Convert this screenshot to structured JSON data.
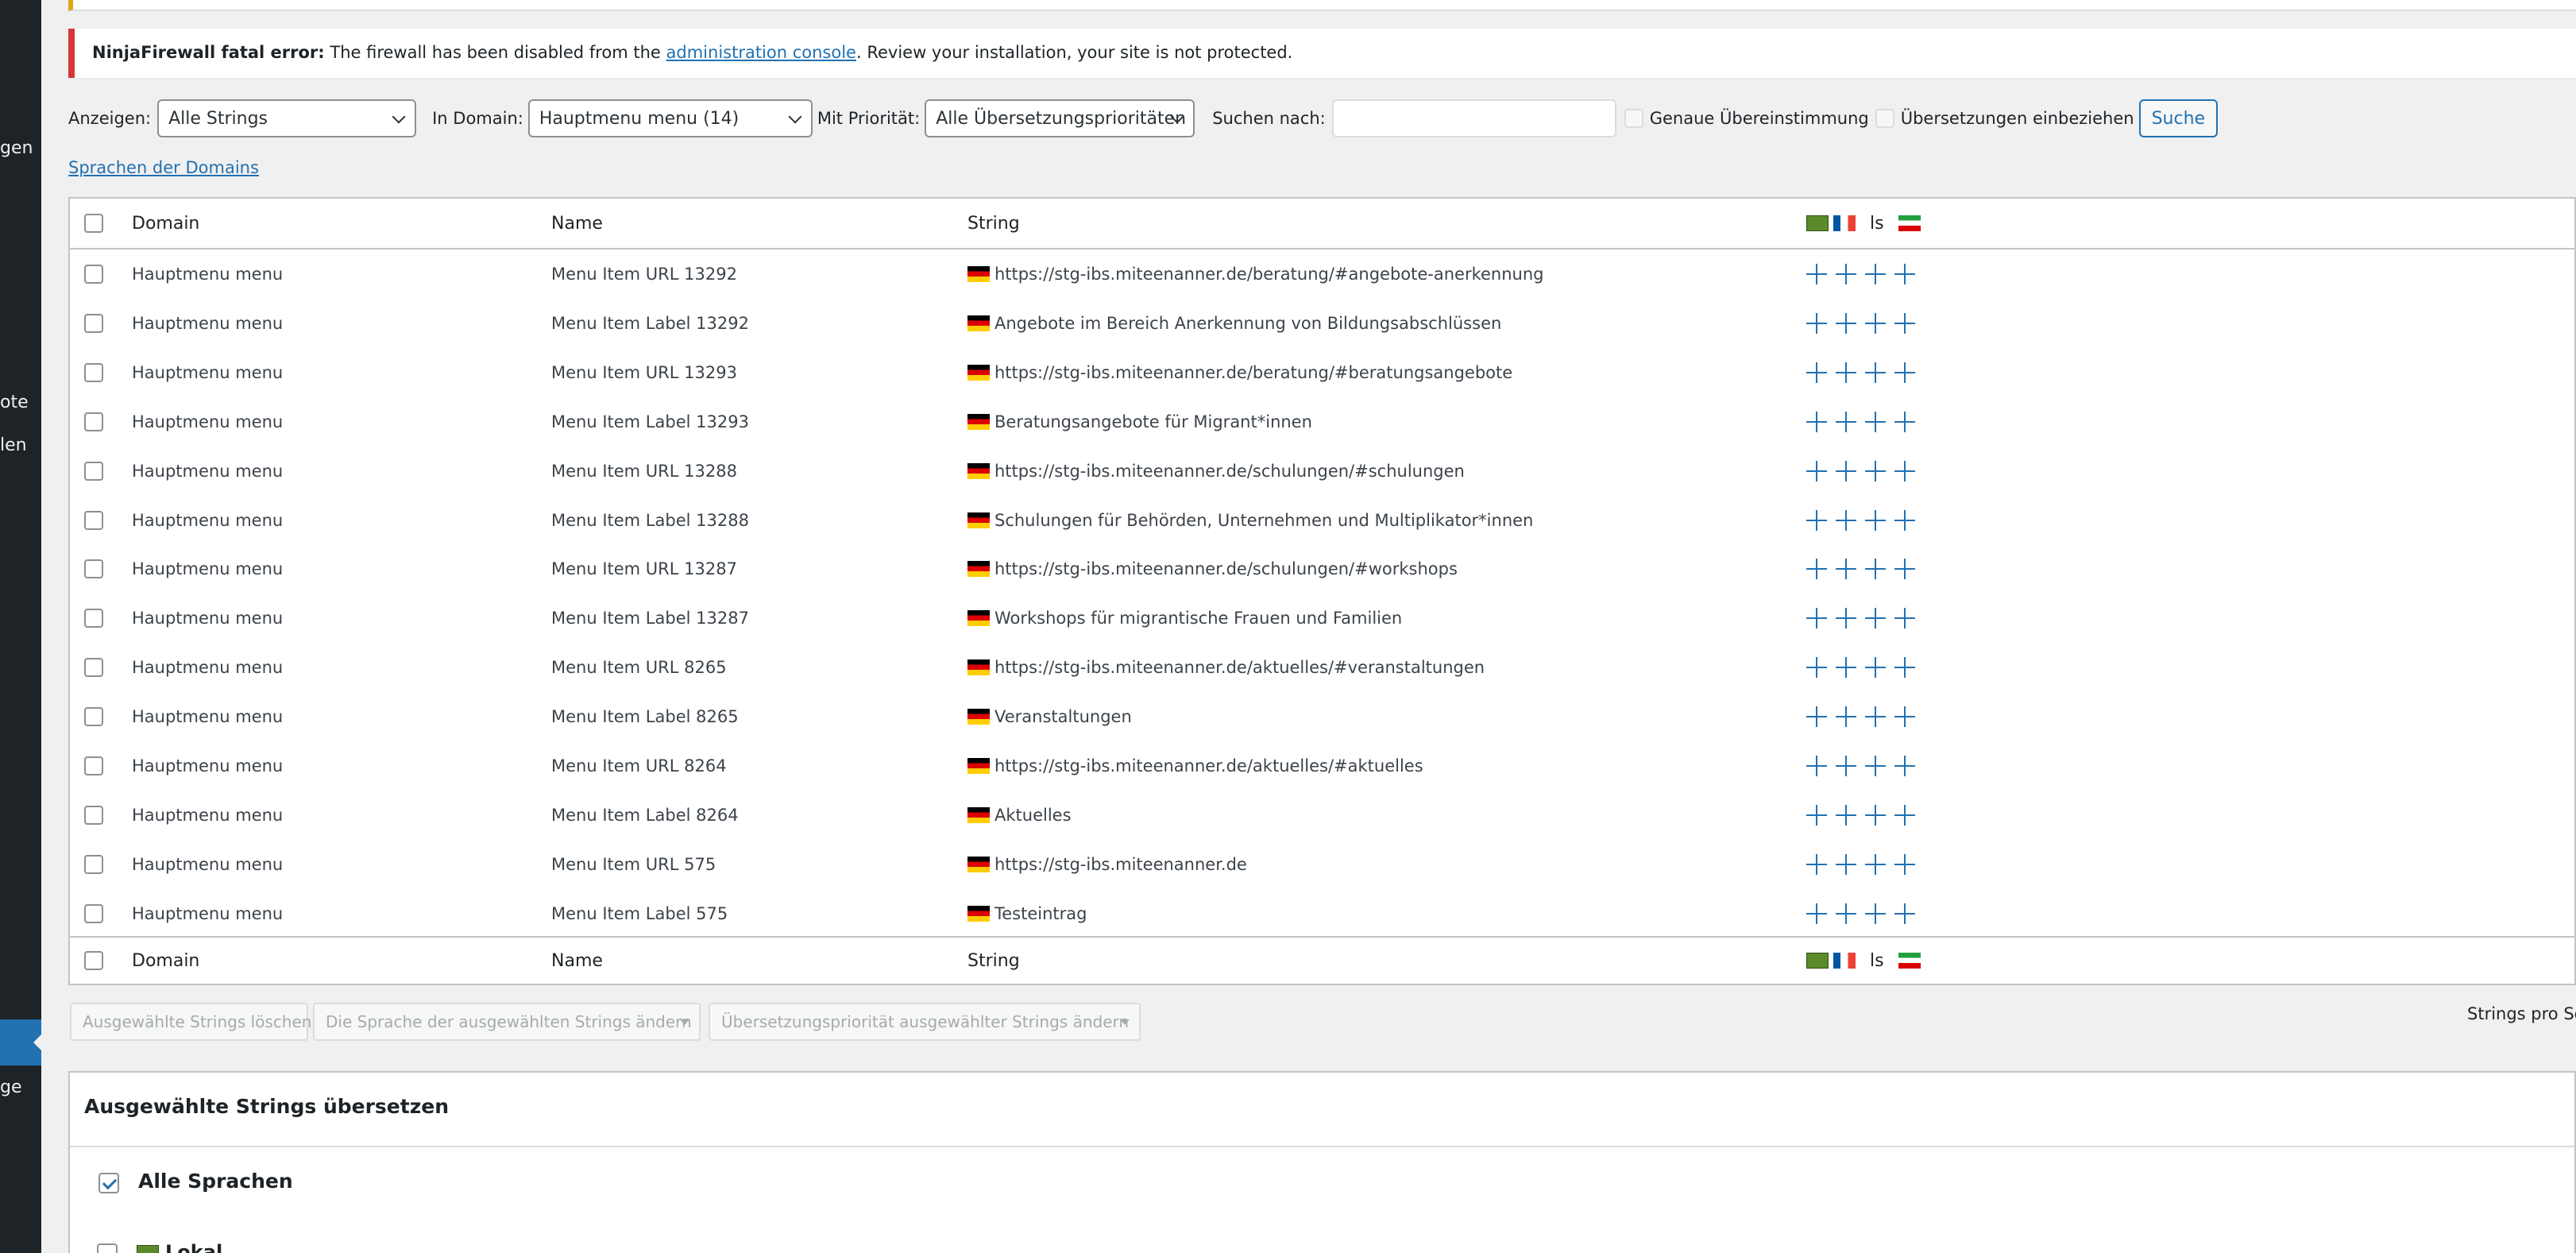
{
  "sidebar": {
    "fragments": [
      "gen",
      "ote",
      "len",
      "ge"
    ]
  },
  "notice": {
    "bold": "NinjaFirewall fatal error:",
    "text1": " The firewall has been disabled from the ",
    "link": "administration console",
    "text2": ". Review your installation, your site is not protected."
  },
  "filters": {
    "show_label": "Anzeigen:",
    "show_value": "Alle Strings",
    "domain_label": "In Domain:",
    "domain_value": "Hauptmenu menu (14)",
    "priority_label": "Mit Priorität:",
    "priority_value": "Alle Übersetzungsprioritäten",
    "search_label": "Suchen nach:",
    "search_value": "",
    "exact_label": "Genaue Übereinstimmung",
    "include_label": "Übersetzungen einbeziehen",
    "search_button": "Suche"
  },
  "domains_link": "Sprachen der Domains",
  "table": {
    "headers": {
      "domain": "Domain",
      "name": "Name",
      "string": "String",
      "ls": "ls"
    },
    "rows": [
      {
        "domain": "Hauptmenu menu",
        "name": "Menu Item URL 13292",
        "string": "https://stg-ibs.miteenanner.de/beratung/#angebote-anerkennung"
      },
      {
        "domain": "Hauptmenu menu",
        "name": "Menu Item Label 13292",
        "string": "Angebote im Bereich Anerkennung von Bildungsabschlüssen"
      },
      {
        "domain": "Hauptmenu menu",
        "name": "Menu Item URL 13293",
        "string": "https://stg-ibs.miteenanner.de/beratung/#beratungsangebote"
      },
      {
        "domain": "Hauptmenu menu",
        "name": "Menu Item Label 13293",
        "string": "Beratungsangebote für Migrant*innen"
      },
      {
        "domain": "Hauptmenu menu",
        "name": "Menu Item URL 13288",
        "string": "https://stg-ibs.miteenanner.de/schulungen/#schulungen"
      },
      {
        "domain": "Hauptmenu menu",
        "name": "Menu Item Label 13288",
        "string": "Schulungen für Behörden, Unternehmen und Multiplikator*innen"
      },
      {
        "domain": "Hauptmenu menu",
        "name": "Menu Item URL 13287",
        "string": "https://stg-ibs.miteenanner.de/schulungen/#workshops"
      },
      {
        "domain": "Hauptmenu menu",
        "name": "Menu Item Label 13287",
        "string": "Workshops für migrantische Frauen und Familien"
      },
      {
        "domain": "Hauptmenu menu",
        "name": "Menu Item URL 8265",
        "string": "https://stg-ibs.miteenanner.de/aktuelles/#veranstaltungen"
      },
      {
        "domain": "Hauptmenu menu",
        "name": "Menu Item Label 8265",
        "string": "Veranstaltungen"
      },
      {
        "domain": "Hauptmenu menu",
        "name": "Menu Item URL 8264",
        "string": "https://stg-ibs.miteenanner.de/aktuelles/#aktuelles"
      },
      {
        "domain": "Hauptmenu menu",
        "name": "Menu Item Label 8264",
        "string": "Aktuelles"
      },
      {
        "domain": "Hauptmenu menu",
        "name": "Menu Item URL 575",
        "string": "https://stg-ibs.miteenanner.de"
      },
      {
        "domain": "Hauptmenu menu",
        "name": "Menu Item Label 575",
        "string": "Testeintrag"
      }
    ]
  },
  "bulk": {
    "delete": "Ausgewählte Strings löschen",
    "change_language": "Die Sprache der ausgewählten Strings ändern",
    "change_priority": "Übersetzungspriorität ausgewählter Strings ändern",
    "per_page": "Strings pro Seite"
  },
  "translate_panel": {
    "title": "Ausgewählte Strings übersetzen",
    "all_languages": "Alle Sprachen",
    "next_language": "Lokal"
  },
  "colors": {
    "accent": "#2271b1",
    "error": "#d63638",
    "sidebar": "#1d2327"
  }
}
